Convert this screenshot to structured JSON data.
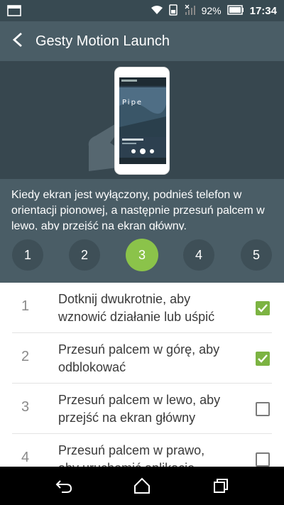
{
  "status_bar": {
    "battery_percent": "92%",
    "time": "17:34",
    "icons": [
      "notification-icon",
      "wifi-icon",
      "phone-data-icon",
      "signal-icon",
      "battery-icon"
    ]
  },
  "app_bar": {
    "title": "Gesty Motion Launch",
    "back_icon": "chevron-left-icon"
  },
  "illustration": {
    "phone_screen": {
      "song_title": "Pipe"
    }
  },
  "instruction": {
    "text": "Kiedy ekran jest wyłączony, podnieś telefon w orientacji pionowej, a następnie przesuń palcem w lewo, aby przejść na ekran główny."
  },
  "steps": {
    "labels": [
      "1",
      "2",
      "3",
      "4",
      "5"
    ],
    "active_index": 2
  },
  "gestures": [
    {
      "number": "1",
      "text": "Dotknij dwukrotnie, aby wznowić działanie lub uśpić",
      "checked": true
    },
    {
      "number": "2",
      "text": "Przesuń palcem w górę, aby odblokować",
      "checked": true
    },
    {
      "number": "3",
      "text": "Przesuń palcem w lewo, aby przejść na ekran główny",
      "checked": false
    },
    {
      "number": "4",
      "text": "Przesuń palcem w prawo, aby uruchomić aplikację Blinkfeed",
      "checked": false
    }
  ],
  "nav_bar": {
    "icons": [
      "back-icon",
      "home-icon",
      "recents-icon"
    ]
  },
  "colors": {
    "header": "#4a5d66",
    "status_bar": "#384a52",
    "accent_green": "#8bc34a",
    "checkbox_green": "#7cb342"
  }
}
